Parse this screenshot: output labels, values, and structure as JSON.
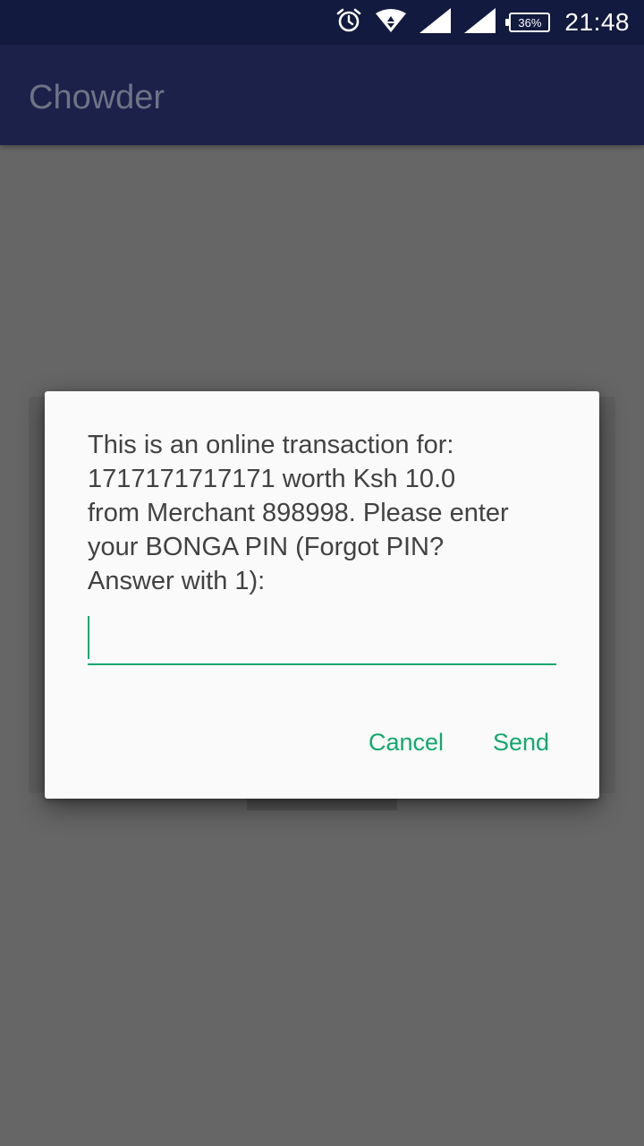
{
  "status_bar": {
    "icons": [
      "alarm-icon",
      "wifi-icon",
      "signal-icon",
      "signal-icon"
    ],
    "battery": "36%",
    "time": "21:48"
  },
  "app_bar": {
    "title": "Chowder"
  },
  "dialog": {
    "message": "This is an online transaction for:\n1717171717171 worth Ksh 10.0\nfrom Merchant 898998. Please enter\nyour BONGA PIN (Forgot PIN?\nAnswer with 1):",
    "input_value": "",
    "cancel_label": "Cancel",
    "send_label": "Send"
  },
  "colors": {
    "status_bar": "#121a3f",
    "app_bar": "#1b2149",
    "accent": "#13a86f",
    "scrim": "#666666",
    "dialog_bg": "#fafafa"
  }
}
